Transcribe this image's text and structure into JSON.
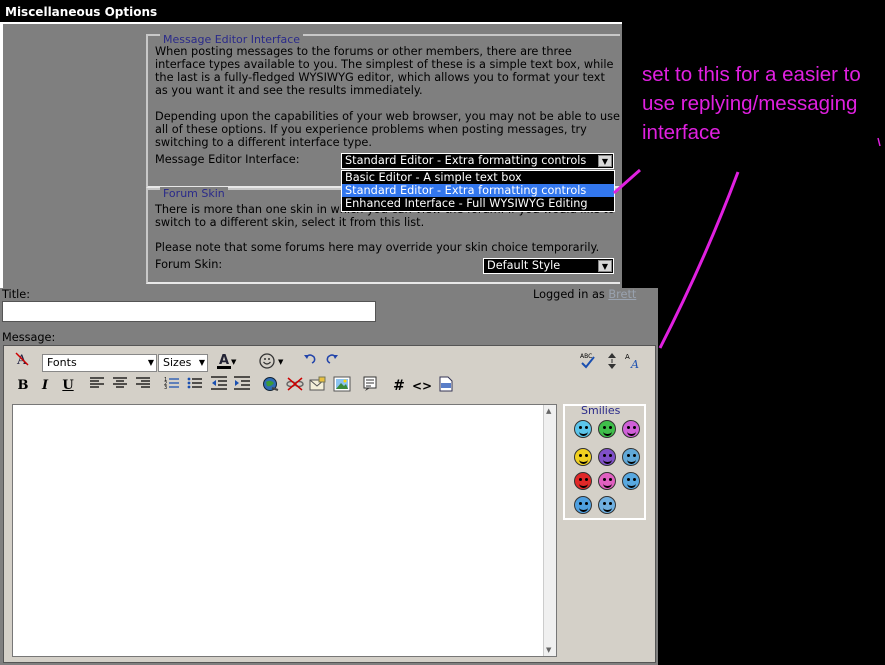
{
  "options": {
    "header": "Miscellaneous Options",
    "editor_section": {
      "legend": "Message Editor Interface",
      "para1": "When posting messages to the forums or other members, there are three interface types available to you. The simplest of these is a simple text box, while the last is a fully-fledged WYSIWYG editor, which allows you to format your text as you want it and see the results immediately.",
      "para2": "Depending upon the capabilities of your web browser, you may not be able to use all of these options. If you experience problems when posting messages, try switching to a different interface type.",
      "field_label": "Message Editor Interface:",
      "selected_value": "Standard Editor - Extra formatting controls",
      "options": [
        "Basic Editor - A simple text box",
        "Standard Editor - Extra formatting controls",
        "Enhanced Interface - Full WYSIWYG Editing"
      ],
      "selected_index": 1
    },
    "skin_section": {
      "legend": "Forum Skin",
      "para1": "There is more than one skin in which you can view the forum. If you would like to switch to a different skin, select it from this list.",
      "para2": "Please note that some forums here may override your skin choice temporarily.",
      "field_label": "Forum Skin:",
      "selected_value": "Default Style"
    }
  },
  "form": {
    "title_label": "Title:",
    "logged_in_label": "Logged in as",
    "logged_in_user": "Brett",
    "message_label": "Message:",
    "toolbar": {
      "fonts": "Fonts",
      "sizes": "Sizes",
      "bold": "B",
      "italic": "I",
      "underline": "U",
      "hash": "#",
      "code": "<>"
    },
    "smilies_label": "Smilies"
  },
  "annotation": {
    "text": "set to this for a easier to use replying/messaging interface",
    "color": "#e020e0"
  },
  "icons": [
    "remove-format-icon",
    "text-color-icon",
    "smiley-menu-icon",
    "undo-icon",
    "redo-icon",
    "spellcheck-icon",
    "resize-icon",
    "switch-mode-icon",
    "align-left-icon",
    "align-center-icon",
    "align-right-icon",
    "ordered-list-icon",
    "unordered-list-icon",
    "outdent-icon",
    "indent-icon",
    "insert-link-icon",
    "unlink-icon",
    "email-link-icon",
    "insert-image-icon",
    "quote-icon",
    "php-icon"
  ]
}
